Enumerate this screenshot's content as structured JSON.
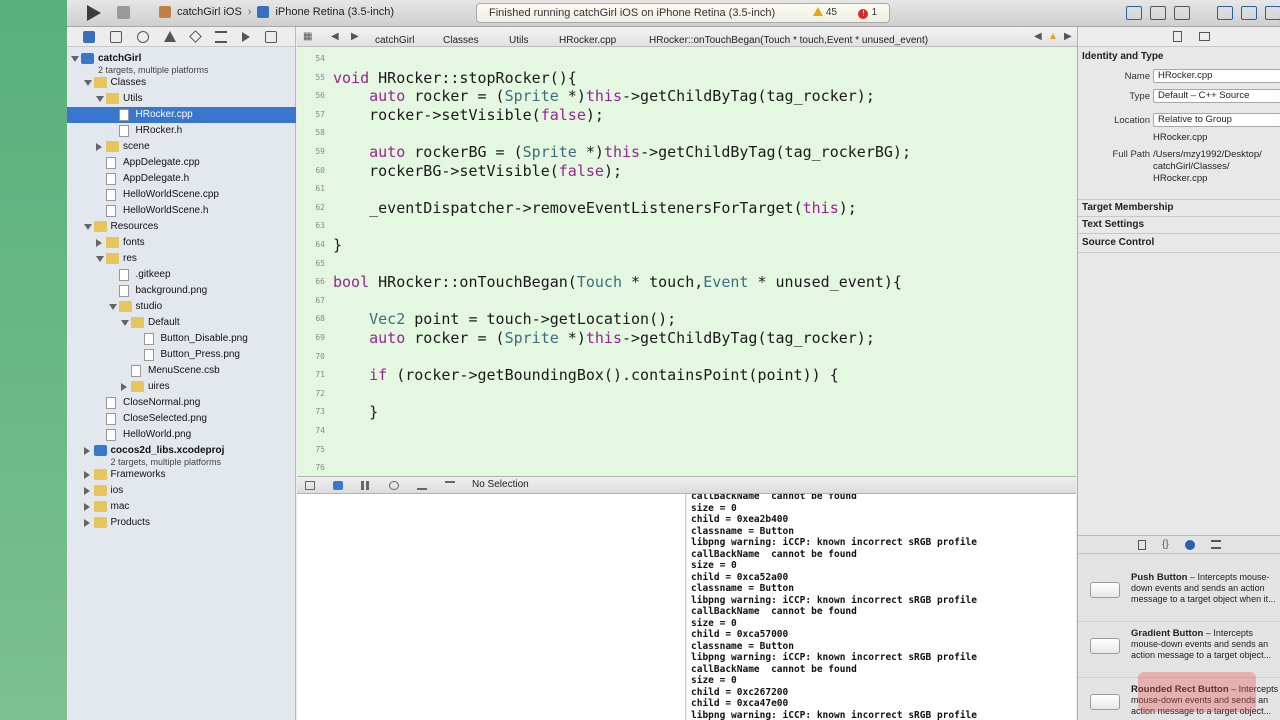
{
  "toolbar": {
    "scheme_project": "catchGirl iOS",
    "scheme_device": "iPhone Retina (3.5-inch)",
    "activity_message": "Finished running catchGirl iOS on iPhone Retina (3.5-inch)",
    "warning_count": "45",
    "error_count": "1"
  },
  "navigator": {
    "rows": [
      {
        "label": "catchGirl",
        "sub": "2 targets, multiple platforms",
        "indent": 0,
        "type": "proj",
        "tri": "open",
        "bold": true
      },
      {
        "label": "Classes",
        "indent": 1,
        "type": "folder",
        "tri": "open"
      },
      {
        "label": "Utils",
        "indent": 2,
        "type": "folder",
        "tri": "open"
      },
      {
        "label": "HRocker.cpp",
        "indent": 3,
        "type": "file",
        "tri": "",
        "selected": true
      },
      {
        "label": "HRocker.h",
        "indent": 3,
        "type": "file",
        "tri": ""
      },
      {
        "label": "scene",
        "indent": 2,
        "type": "folder",
        "tri": "closed"
      },
      {
        "label": "AppDelegate.cpp",
        "indent": 2,
        "type": "file",
        "tri": ""
      },
      {
        "label": "AppDelegate.h",
        "indent": 2,
        "type": "file",
        "tri": ""
      },
      {
        "label": "HelloWorldScene.cpp",
        "indent": 2,
        "type": "file",
        "tri": ""
      },
      {
        "label": "HelloWorldScene.h",
        "indent": 2,
        "type": "file",
        "tri": ""
      },
      {
        "label": "Resources",
        "indent": 1,
        "type": "folder",
        "tri": "open"
      },
      {
        "label": "fonts",
        "indent": 2,
        "type": "folder",
        "tri": "closed"
      },
      {
        "label": "res",
        "indent": 2,
        "type": "folder",
        "tri": "open"
      },
      {
        "label": ".gitkeep",
        "indent": 3,
        "type": "file",
        "tri": ""
      },
      {
        "label": "background.png",
        "indent": 3,
        "type": "file",
        "tri": ""
      },
      {
        "label": "studio",
        "indent": 3,
        "type": "folder",
        "tri": "open"
      },
      {
        "label": "Default",
        "indent": 4,
        "type": "folder",
        "tri": "open"
      },
      {
        "label": "Button_Disable.png",
        "indent": 5,
        "type": "file",
        "tri": ""
      },
      {
        "label": "Button_Press.png",
        "indent": 5,
        "type": "file",
        "tri": ""
      },
      {
        "label": "MenuScene.csb",
        "indent": 4,
        "type": "file",
        "tri": ""
      },
      {
        "label": "uires",
        "indent": 4,
        "type": "folder",
        "tri": "closed"
      },
      {
        "label": "CloseNormal.png",
        "indent": 2,
        "type": "file",
        "tri": ""
      },
      {
        "label": "CloseSelected.png",
        "indent": 2,
        "type": "file",
        "tri": ""
      },
      {
        "label": "HelloWorld.png",
        "indent": 2,
        "type": "file",
        "tri": ""
      },
      {
        "label": "cocos2d_libs.xcodeproj",
        "sub": "2 targets, multiple platforms",
        "indent": 1,
        "type": "proj",
        "tri": "closed",
        "bold": true
      },
      {
        "label": "Frameworks",
        "indent": 1,
        "type": "folder",
        "tri": "closed"
      },
      {
        "label": "ios",
        "indent": 1,
        "type": "folder",
        "tri": "closed"
      },
      {
        "label": "mac",
        "indent": 1,
        "type": "folder",
        "tri": "closed"
      },
      {
        "label": "Products",
        "indent": 1,
        "type": "folder",
        "tri": "closed"
      }
    ]
  },
  "jumpbar": {
    "crumbs": [
      "catchGirl",
      "Classes",
      "Utils",
      "HRocker.cpp",
      "HRocker::onTouchBegan(Touch * touch,Event * unused_event)"
    ]
  },
  "editor": {
    "lines": [
      {
        "n": "54",
        "code": ""
      },
      {
        "n": "55",
        "code": "void HRocker::stopRocker(){"
      },
      {
        "n": "56",
        "code": "    auto rocker = (Sprite *)this->getChildByTag(tag_rocker);"
      },
      {
        "n": "57",
        "code": "    rocker->setVisible(false);"
      },
      {
        "n": "58",
        "code": ""
      },
      {
        "n": "59",
        "code": "    auto rockerBG = (Sprite *)this->getChildByTag(tag_rockerBG);"
      },
      {
        "n": "60",
        "code": "    rockerBG->setVisible(false);"
      },
      {
        "n": "61",
        "code": ""
      },
      {
        "n": "62",
        "code": "    _eventDispatcher->removeEventListenersForTarget(this);"
      },
      {
        "n": "63",
        "code": ""
      },
      {
        "n": "64",
        "code": "}"
      },
      {
        "n": "65",
        "code": ""
      },
      {
        "n": "66",
        "code": "bool HRocker::onTouchBegan(Touch * touch,Event * unused_event){"
      },
      {
        "n": "67",
        "code": ""
      },
      {
        "n": "68",
        "code": "    Vec2 point = touch->getLocation();"
      },
      {
        "n": "69",
        "code": "    auto rocker = (Sprite *)this->getChildByTag(tag_rocker);"
      },
      {
        "n": "70",
        "code": ""
      },
      {
        "n": "71",
        "code": "    if (rocker->getBoundingBox().containsPoint(point)) {"
      },
      {
        "n": "72",
        "code": ""
      },
      {
        "n": "73",
        "code": "    }"
      },
      {
        "n": "74",
        "code": ""
      },
      {
        "n": "75",
        "code": ""
      },
      {
        "n": "76",
        "code": ""
      }
    ]
  },
  "debugbar": {
    "selection": "No Selection"
  },
  "console": {
    "lines": [
      "callBackName  cannot be found",
      "size = 0",
      "child = 0xea2b400",
      "classname = Button",
      "libpng warning: iCCP: known incorrect sRGB profile",
      "callBackName  cannot be found",
      "size = 0",
      "child = 0xca52a00",
      "classname = Button",
      "libpng warning: iCCP: known incorrect sRGB profile",
      "callBackName  cannot be found",
      "size = 0",
      "child = 0xca57000",
      "classname = Button",
      "libpng warning: iCCP: known incorrect sRGB profile",
      "callBackName  cannot be found",
      "size = 0",
      "child = 0xc267200",
      "child = 0xca47e00",
      "libpng warning: iCCP: known incorrect sRGB profile"
    ]
  },
  "inspector": {
    "identity_title": "Identity and Type",
    "name_label": "Name",
    "name_value": "HRocker.cpp",
    "type_label": "Type",
    "type_value": "Default – C++ Source",
    "location_label": "Location",
    "location_value": "Relative to Group",
    "location_file": "HRocker.cpp",
    "fullpath_label": "Full Path",
    "fullpath_1": "/Users/mzy1992/Desktop/",
    "fullpath_2": "catchGirl/Classes/",
    "fullpath_3": "HRocker.cpp",
    "target_membership": "Target Membership",
    "text_settings": "Text Settings",
    "source_control": "Source Control"
  },
  "library": {
    "items": [
      {
        "title": "Push Button",
        "desc": " – Intercepts mouse-down events and sends an action message to a target object when it..."
      },
      {
        "title": "Gradient Button",
        "desc": " – Intercepts mouse-down events and sends an action message to a target object..."
      },
      {
        "title": "Rounded Rect Button",
        "desc": " – Intercepts mouse-down events and sends an action message to a target object..."
      }
    ]
  },
  "colors": {
    "selection": "#3876d0",
    "editor_bg": "#e4f7e0",
    "keyword": "#9b2393"
  }
}
